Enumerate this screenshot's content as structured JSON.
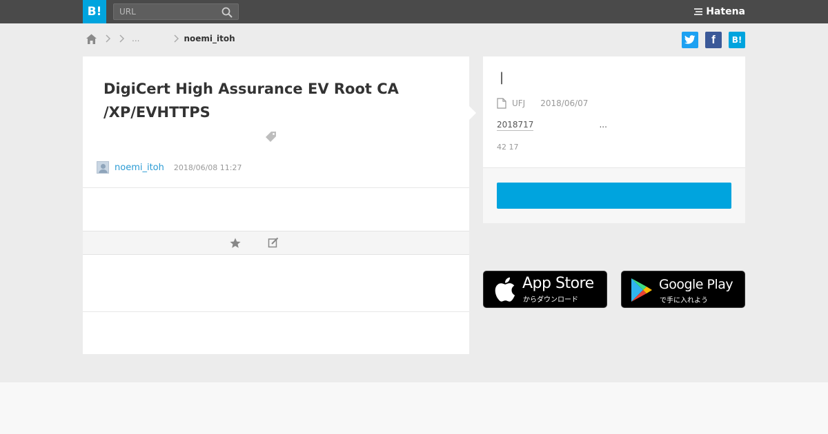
{
  "header": {
    "logo_label": "B!",
    "search_placeholder": "URL",
    "brand_name": "Hatena"
  },
  "breadcrumb": {
    "ellipsis": "...",
    "current": "noemi_itoh"
  },
  "share": {
    "twitter_label": "",
    "facebook_label": "f",
    "hatena_label": "B!"
  },
  "entry": {
    "title_line1": "DigiCert High Assurance EV Root CA",
    "title_line2": "/XP/EVHTTPS",
    "author": "noemi_itoh",
    "date": "2018/06/08 11:27"
  },
  "side": {
    "title": "|",
    "site": "UFJ",
    "date": "2018/06/07",
    "desc_link": "2018717",
    "desc_more": "...",
    "count": "42 17"
  },
  "badges": {
    "appstore_title": "App Store",
    "appstore_sub": "からダウンロード",
    "googleplay_title": "Google Play",
    "googleplay_sub": "で手に入れよう"
  },
  "colors": {
    "topbar": "#4a4a4a",
    "accent": "#00a4de",
    "link": "#2a9bd4"
  }
}
